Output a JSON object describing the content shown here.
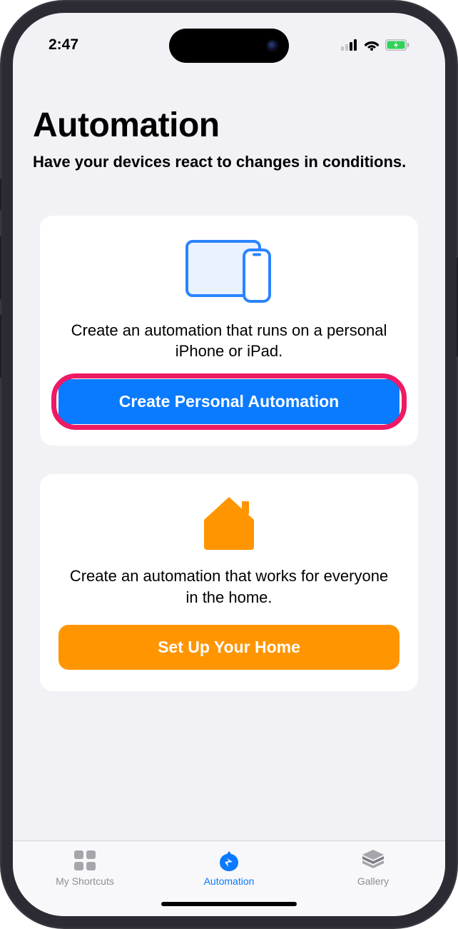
{
  "status": {
    "time": "2:47"
  },
  "header": {
    "title": "Automation",
    "subtitle": "Have your devices react to changes in conditions."
  },
  "cards": {
    "personal": {
      "description": "Create an automation that runs on a personal iPhone or iPad.",
      "button_label": "Create Personal Automation"
    },
    "home": {
      "description": "Create an automation that works for everyone in the home.",
      "button_label": "Set Up Your Home"
    }
  },
  "tabs": {
    "shortcuts": "My Shortcuts",
    "automation": "Automation",
    "gallery": "Gallery"
  },
  "colors": {
    "accent_blue": "#0a7aff",
    "accent_orange": "#ff9500",
    "highlight": "#ed1a64"
  }
}
